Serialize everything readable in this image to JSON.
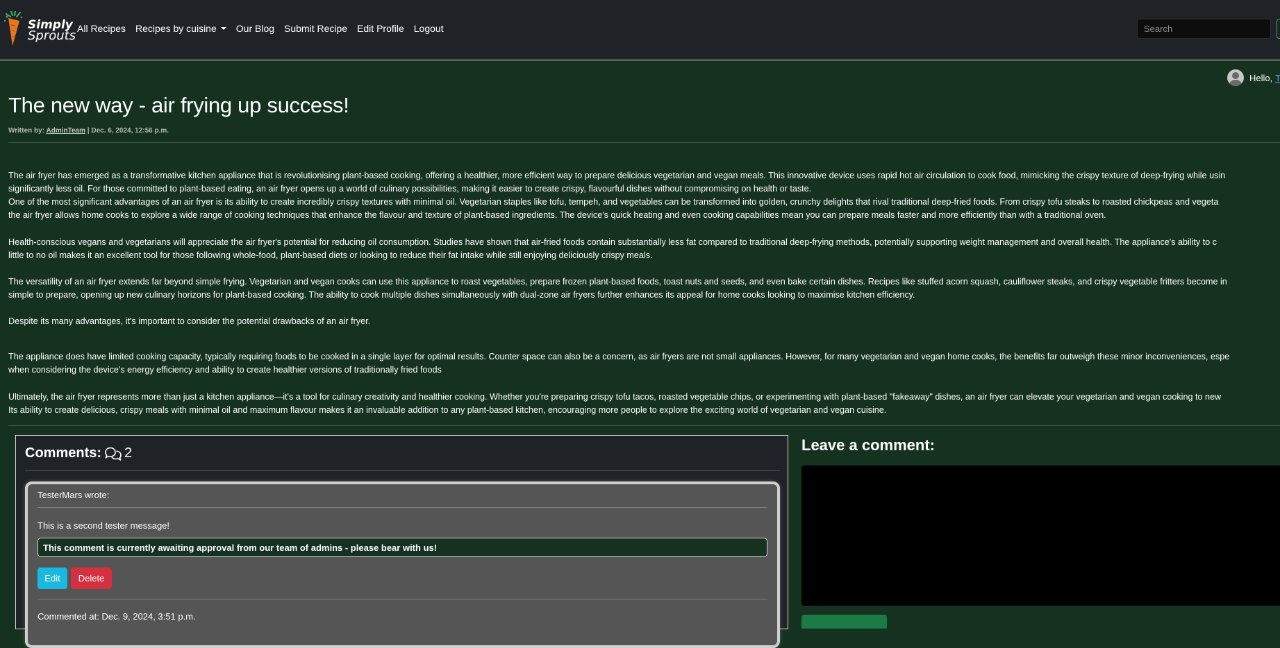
{
  "brand": {
    "line1": "Simply",
    "line2": "Sprouts"
  },
  "nav": {
    "all_recipes": "All Recipes",
    "recipes_by_cuisine": "Recipes by cuisine",
    "our_blog": "Our Blog",
    "submit_recipe": "Submit Recipe",
    "edit_profile": "Edit Profile",
    "logout": "Logout"
  },
  "search": {
    "placeholder": "Search"
  },
  "greeting": {
    "prefix": "Hello,",
    "username": "T"
  },
  "post": {
    "title": "The new way - air frying up success!",
    "written_by_label": "Written by:",
    "author": "AdminTeam",
    "separator": "|",
    "date": "Dec. 6, 2024, 12:56 p.m.",
    "paragraphs": [
      {
        "lines": [
          "The air fryer has emerged as a transformative kitchen appliance that is revolutionising plant-based cooking, offering a healthier, more efficient way to prepare delicious vegetarian and vegan meals. This innovative device uses rapid hot air circulation to cook food, mimicking the crispy texture of deep-frying while usin",
          "significantly less oil. For those committed to plant-based eating, an air fryer opens up a world of culinary possibilities, making it easier to create crispy, flavourful dishes without compromising on health or taste."
        ]
      },
      {
        "lines": [
          "One of the most significant advantages of an air fryer is its ability to create incredibly crispy textures with minimal oil. Vegetarian staples like tofu, tempeh, and vegetables can be transformed into golden, crunchy delights that rival traditional deep-fried foods. From crispy tofu steaks to roasted chickpeas and vegeta",
          "the air fryer allows home cooks to explore a wide range of cooking techniques that enhance the flavour and texture of plant-based ingredients. The device's quick heating and even cooking capabilities mean you can prepare meals faster and more efficiently than with a traditional oven."
        ]
      },
      {
        "lines": [
          "Health-conscious vegans and vegetarians will appreciate the air fryer's potential for reducing oil consumption. Studies have shown that air-fried foods contain substantially less fat compared to traditional deep-frying methods, potentially supporting weight management and overall health. The appliance's ability to c",
          "little to no oil makes it an excellent tool for those following whole-food, plant-based diets or looking to reduce their fat intake while still enjoying deliciously crispy meals."
        ]
      },
      {
        "lines": [
          "The versatility of an air fryer extends far beyond simple frying. Vegetarian and vegan cooks can use this appliance to roast vegetables, prepare frozen plant-based foods, toast nuts and seeds, and even bake certain dishes. Recipes like stuffed acorn squash, cauliflower steaks, and crispy vegetable fritters become in",
          "simple to prepare, opening up new culinary horizons for plant-based cooking. The ability to cook multiple dishes simultaneously with dual-zone air fryers further enhances its appeal for home cooks looking to maximise kitchen efficiency."
        ]
      },
      {
        "lines": [
          "Despite its many advantages, it's important to consider the potential drawbacks of an air fryer."
        ]
      },
      {
        "lines": [
          "The appliance does have limited cooking capacity, typically requiring foods to be cooked in a single layer for optimal results. Counter space can also be a concern, as air fryers are not small appliances. However, for many vegetarian and vegan home cooks, the benefits far outweigh these minor inconveniences, espe",
          "when considering the device's energy efficiency and ability to create healthier versions of traditionally fried foods"
        ]
      },
      {
        "lines": [
          "Ultimately, the air fryer represents more than just a kitchen appliance—it's a tool for culinary creativity and healthier cooking. Whether you're preparing crispy tofu tacos, roasted vegetable chips, or experimenting with plant-based \"fakeaway\" dishes, an air fryer can elevate your vegetarian and vegan cooking to new",
          "Its ability to create delicious, crispy meals with minimal oil and maximum flavour makes it an invaluable addition to any plant-based kitchen, encouraging more people to explore the exciting world of vegetarian and vegan cuisine."
        ]
      }
    ]
  },
  "comments": {
    "label": "Comments:",
    "icon": "chat-bubbles-icon",
    "count": "2",
    "items": [
      {
        "author_line": "TesterMars wrote:",
        "body": "This is a second tester message!",
        "awaiting_notice": "This comment is currently awaiting approval from our team of admins - please bear with us!",
        "edit_label": "Edit",
        "delete_label": "Delete",
        "timestamp": "Commented at: Dec. 9, 2024, 3:51 p.m."
      }
    ]
  },
  "leave_comment": {
    "title": "Leave a comment:"
  },
  "colors": {
    "page_bg": "#15311f",
    "navbar_bg": "#1f2327",
    "edit_button": "#18b8e0",
    "delete_button": "#d62f3f",
    "submit_button": "#1c7a47",
    "link": "#5aa7e6"
  }
}
